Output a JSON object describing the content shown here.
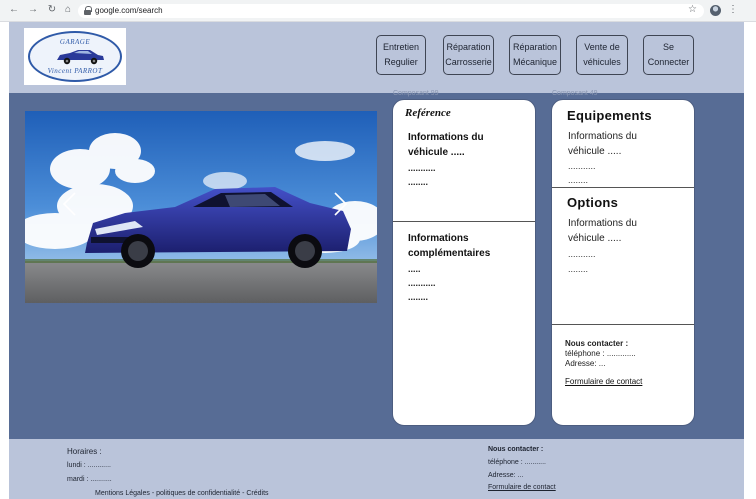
{
  "browser": {
    "url": "google.com/search",
    "back_icon": "arrow-left-icon",
    "forward_icon": "arrow-right-icon",
    "reload_icon": "reload-icon",
    "home_icon": "home-icon",
    "bookmark_icon": "star-icon",
    "menu_icon": "kebab-menu-icon"
  },
  "logo": {
    "top_text": "GARAGE",
    "bottom_text": "Vincent   PARROT",
    "color": "#2f5aa8"
  },
  "nav": [
    {
      "line1": "Entretien",
      "line2": "Regulier"
    },
    {
      "line1": "Réparation",
      "line2": "Carrosserie"
    },
    {
      "line1": "Réparation",
      "line2": "Mécanique"
    },
    {
      "line1": "Vente de",
      "line2": "véhicules"
    },
    {
      "line1": "Se",
      "line2": "Connecter"
    }
  ],
  "colors": {
    "header_bg": "#bac4da",
    "main_bg": "#576c95",
    "panel_bg": "#ffffff",
    "car_body": "#2a2f8f"
  },
  "carousel": {
    "prev_icon": "chevron-left-icon",
    "next_icon": "chevron-right-icon"
  },
  "ghost_labels": {
    "left": "Composant 99",
    "right": "Composant 49"
  },
  "reference_panel": {
    "title": "Reférence",
    "info_title_1": "Informations du",
    "info_title_2": "véhicule .....",
    "info_dots_1": "...........",
    "info_dots_2": "........",
    "extra_title_1": "Informations",
    "extra_title_2": "complémentaires",
    "extra_dots_1": ".....",
    "extra_dots_2": "...........",
    "extra_dots_3": "........"
  },
  "equipment_panel": {
    "title": "Equipements",
    "line1": "Informations du",
    "line2": "véhicule .....",
    "dots1": "...........",
    "dots2": "........",
    "options_title": "Options",
    "opt_line1": "Informations du",
    "opt_line2": "véhicule .....",
    "opt_dots1": "...........",
    "opt_dots2": "........",
    "contact_title": "Nous contacter :",
    "contact_phone": "téléphone  : .............",
    "contact_address": "Adresse: ...",
    "contact_link": "Formulaire de contact"
  },
  "footer": {
    "hours_title": "Horaires :",
    "monday": "lundi : ............",
    "tuesday": "mardi : ...........",
    "legal": "Mentions Légales - politiques de confidentialité - Crédits",
    "contact_title": "Nous contacter :",
    "phone": "téléphone  : ...........",
    "address": "Adresse: ...",
    "link": "Formulaire de contact"
  }
}
